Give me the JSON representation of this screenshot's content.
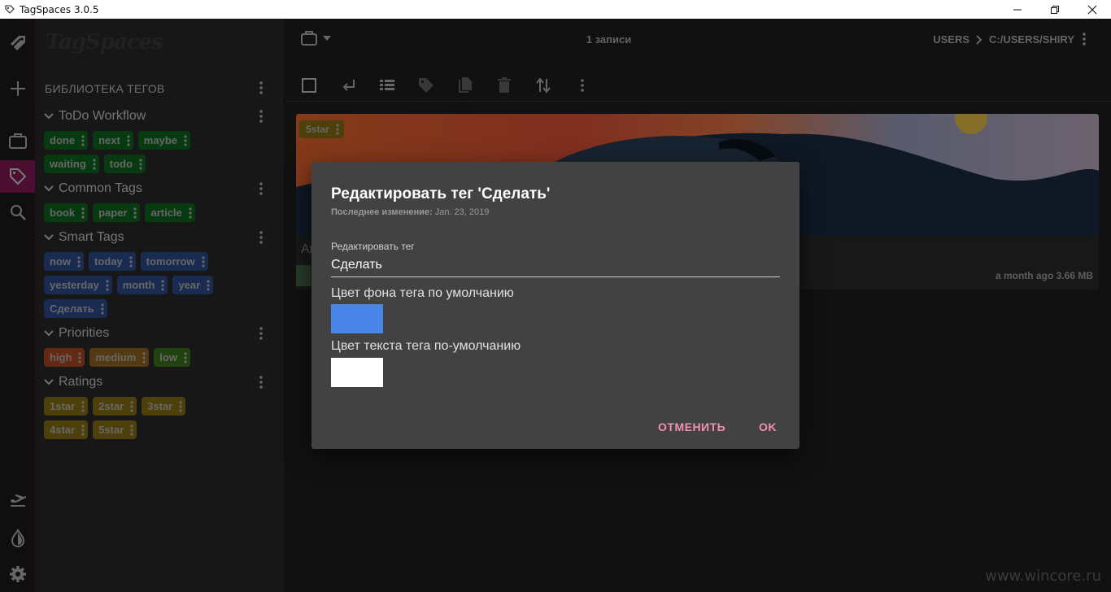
{
  "window": {
    "title": "TagSpaces 3.0.5",
    "controls": [
      "minimize-icon",
      "restore-icon",
      "close-icon"
    ]
  },
  "leftnav": {
    "top_icons": [
      "tagspaces-logo-icon",
      "plus-icon",
      "briefcase-icon",
      "tag-icon",
      "search-icon"
    ],
    "bottom_icons": [
      "airplane-icon",
      "theme-drop-icon",
      "gear-icon"
    ],
    "active": "tag-icon",
    "accent": "#8a1a5a"
  },
  "tag_library": {
    "logo": "TagSpaces",
    "title": "БИБЛИОТЕКА ТЕГОВ",
    "groups": [
      {
        "name": "ToDo Workflow",
        "rows": [
          [
            {
              "label": "done",
              "color": "#0e6a1e"
            },
            {
              "label": "next",
              "color": "#0e6a1e"
            },
            {
              "label": "maybe",
              "color": "#0e6a1e"
            }
          ],
          [
            {
              "label": "waiting",
              "color": "#0e6a1e"
            },
            {
              "label": "todo",
              "color": "#0e6a1e"
            }
          ]
        ]
      },
      {
        "name": "Common Tags",
        "rows": [
          [
            {
              "label": "book",
              "color": "#0e6a1e"
            },
            {
              "label": "paper",
              "color": "#0e6a1e"
            },
            {
              "label": "article",
              "color": "#0e6a1e"
            }
          ]
        ]
      },
      {
        "name": "Smart Tags",
        "rows": [
          [
            {
              "label": "now",
              "color": "#2e4f94"
            },
            {
              "label": "today",
              "color": "#2e4f94"
            },
            {
              "label": "tomorrow",
              "color": "#2e4f94"
            }
          ],
          [
            {
              "label": "yesterday",
              "color": "#2e4f94"
            },
            {
              "label": "month",
              "color": "#2e4f94"
            },
            {
              "label": "year",
              "color": "#2e4f94"
            }
          ],
          [
            {
              "label": "Сделать",
              "color": "#2e4f94"
            }
          ]
        ]
      },
      {
        "name": "Priorities",
        "rows": [
          [
            {
              "label": "high",
              "color": "#b54b22"
            },
            {
              "label": "medium",
              "color": "#9a6a22"
            },
            {
              "label": "low",
              "color": "#3d7a1d"
            }
          ]
        ]
      },
      {
        "name": "Ratings",
        "rows": [
          [
            {
              "label": "1star",
              "color": "#8f7514"
            },
            {
              "label": "2star",
              "color": "#8f7514"
            },
            {
              "label": "3star",
              "color": "#8f7514"
            }
          ],
          [
            {
              "label": "4star",
              "color": "#8f7514"
            },
            {
              "label": "5star",
              "color": "#8f7514"
            }
          ]
        ]
      }
    ]
  },
  "main": {
    "counter": "1 записи",
    "breadcrumb": [
      "USERS",
      "C:/USERS/SHIRY"
    ],
    "toolbar_icons": [
      "select-all-icon",
      "parent-folder-icon",
      "view-list-icon",
      "tag-icon",
      "copy-move-icon",
      "delete-icon",
      "sort-icon",
      "more-icon"
    ],
    "file_card": {
      "tag": "5star",
      "name_partial": "Ar",
      "meta": "a month ago 3.66 MB"
    }
  },
  "dialog": {
    "title": "Редактировать тег 'Сделать'",
    "modified_label": "Последнее изменение:",
    "modified_value": "Jan. 23, 2019",
    "field_label": "Редактировать тег",
    "field_value": "Сделать",
    "bg_color_label": "Цвет фона тега по умолчанию",
    "bg_color": "#4a86e8",
    "text_color_label": "Цвет текста тега по-умолчанию",
    "text_color": "#ffffff",
    "cancel_label": "ОТМЕНИТЬ",
    "ok_label": "OK",
    "accent": "#f48fb1"
  },
  "watermark": "www.wincore.ru"
}
